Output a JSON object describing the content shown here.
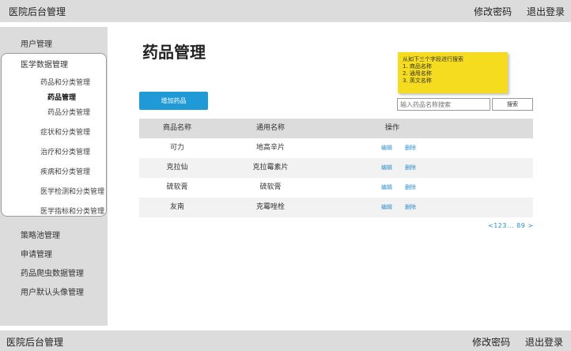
{
  "header": {
    "brand": "医院后台管理",
    "change_password": "修改密码",
    "logout": "退出登录"
  },
  "footer": {
    "brand": "医院后台管理",
    "change_password": "修改密码",
    "logout": "退出登录"
  },
  "sidebar": {
    "items": [
      "用户管理",
      "医学数据管理",
      "策略池管理",
      "申请管理",
      "药品爬虫数据管理",
      "用户默认头像管理"
    ],
    "sub_items": [
      "药品和分类管理",
      "药品管理",
      "药品分类管理",
      "症状和分类管理",
      "治疗和分类管理",
      "疾病和分类管理",
      "医学检测和分类管理",
      "医学指标和分类管理"
    ],
    "active_sub": "药品管理"
  },
  "main": {
    "title": "药品管理",
    "note_lines": [
      "从如下三个字段进行搜索",
      "1. 商品名称",
      "2. 通用名称",
      "3. 英文名称"
    ],
    "add_button": "增加药品",
    "search_placeholder": "输入药品名称搜索",
    "search_button": "搜索",
    "table": {
      "headers": [
        "商品名称",
        "通用名称",
        "操作"
      ],
      "rows": [
        [
          "可力",
          "地高辛片"
        ],
        [
          "克拉仙",
          "克拉霉素片"
        ],
        [
          "硫软膏",
          "硫软膏"
        ],
        [
          "友南",
          "克霉唑栓"
        ]
      ],
      "actions": [
        "编辑",
        "删除"
      ]
    },
    "pagination": "<123... 89 >"
  },
  "colors": {
    "accent": "#1f9ad6",
    "note": "#f5dc1f",
    "bar": "#dcdcdc",
    "link": "#2a8fd0"
  }
}
